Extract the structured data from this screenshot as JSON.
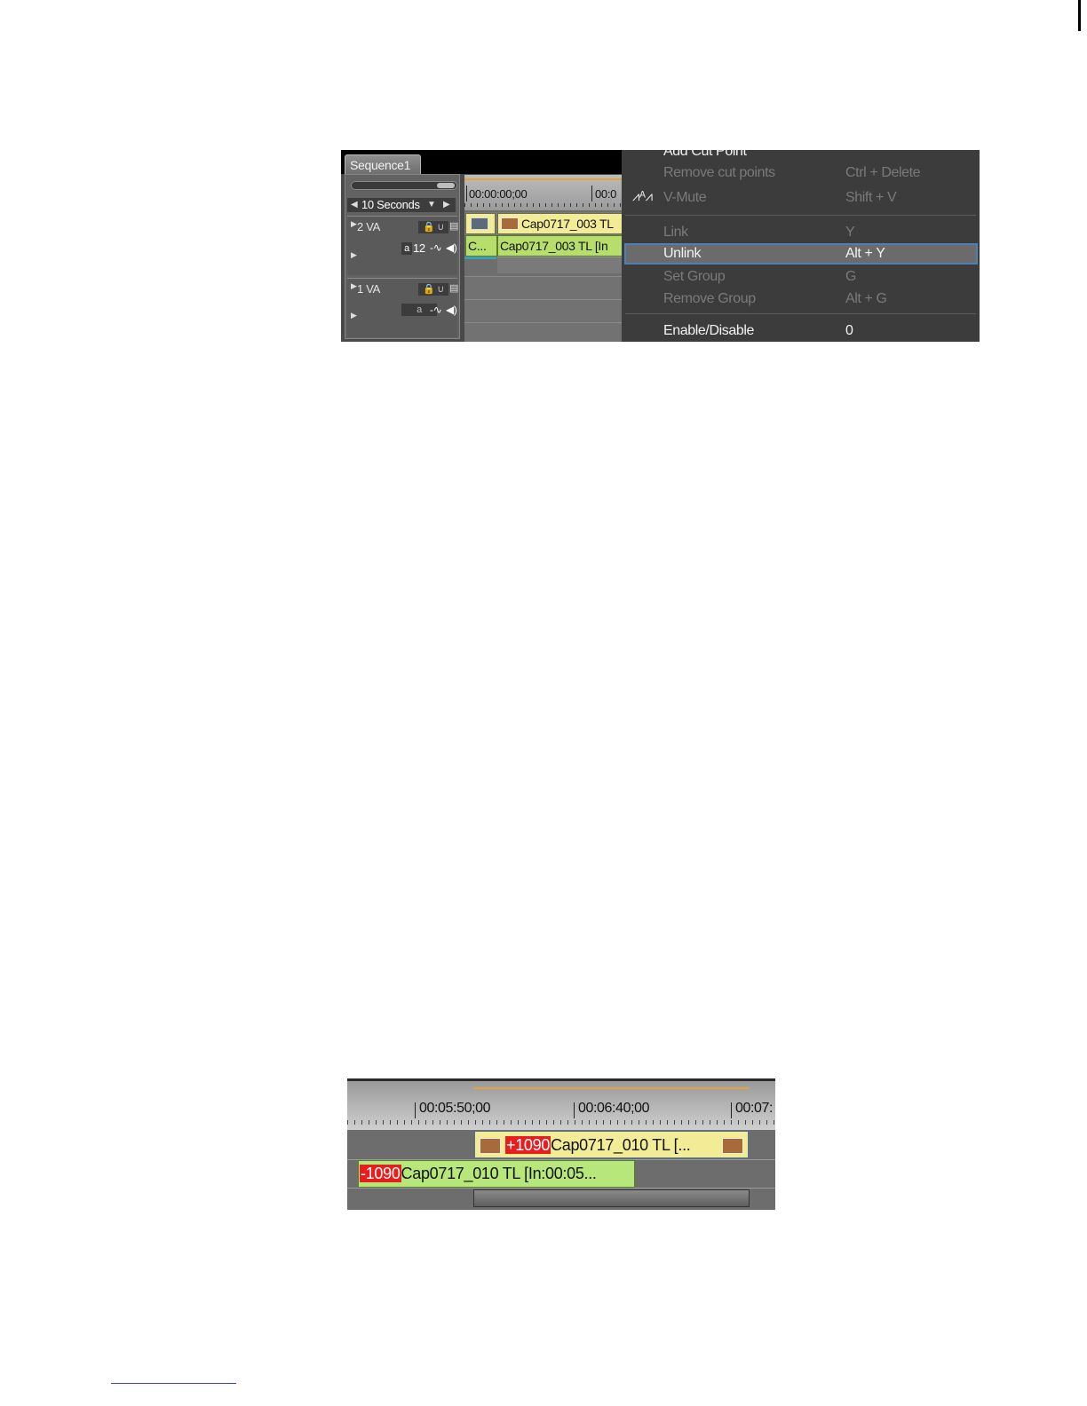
{
  "screenshot1": {
    "sequence_tab": "Sequence1",
    "zoom_label": "10 Seconds",
    "tracks": [
      {
        "name": "2 VA",
        "audio_channel": "12"
      },
      {
        "name": "1 VA"
      }
    ],
    "ruler_timecode": "00:00:00;00",
    "ruler_timecode_partial": "00:0",
    "clips": {
      "video_clip": "Cap0717_003  TL",
      "audio_clip_short": "C...",
      "audio_clip": "Cap0717_003  TL [In"
    },
    "context_menu": [
      {
        "label": "Add Cut Point",
        "shortcut": "",
        "enabled": true
      },
      {
        "label": "Remove cut points",
        "shortcut": "Ctrl + Delete",
        "enabled": false
      },
      {
        "label": "V-Mute",
        "shortcut": "Shift + V",
        "enabled": false,
        "icon": "v-mute-icon"
      },
      {
        "label": "Link",
        "shortcut": "Y",
        "enabled": false
      },
      {
        "label": "Unlink",
        "shortcut": "Alt + Y",
        "enabled": true,
        "highlighted": true
      },
      {
        "label": "Set Group",
        "shortcut": "G",
        "enabled": false
      },
      {
        "label": "Remove Group",
        "shortcut": "Alt + G",
        "enabled": false
      },
      {
        "label": "Enable/Disable",
        "shortcut": "0",
        "enabled": true
      }
    ]
  },
  "screenshot2": {
    "timecodes": [
      "00:05:50;00",
      "00:06:40;00",
      "00:07:"
    ],
    "video_clip": {
      "offset": "+1090",
      "name": "Cap0717_010  TL  [..."
    },
    "audio_clip": {
      "offset": "-1090",
      "name": "Cap0717_010  TL  [In:00:05..."
    }
  },
  "colors": {
    "accent_orange": "#e3a33a",
    "offset_red": "#e81e1e",
    "video_clip_yellow": "#f2ec97",
    "audio_clip_green": "#b7dd6a",
    "menu_highlight_border": "#4f7fb5"
  }
}
